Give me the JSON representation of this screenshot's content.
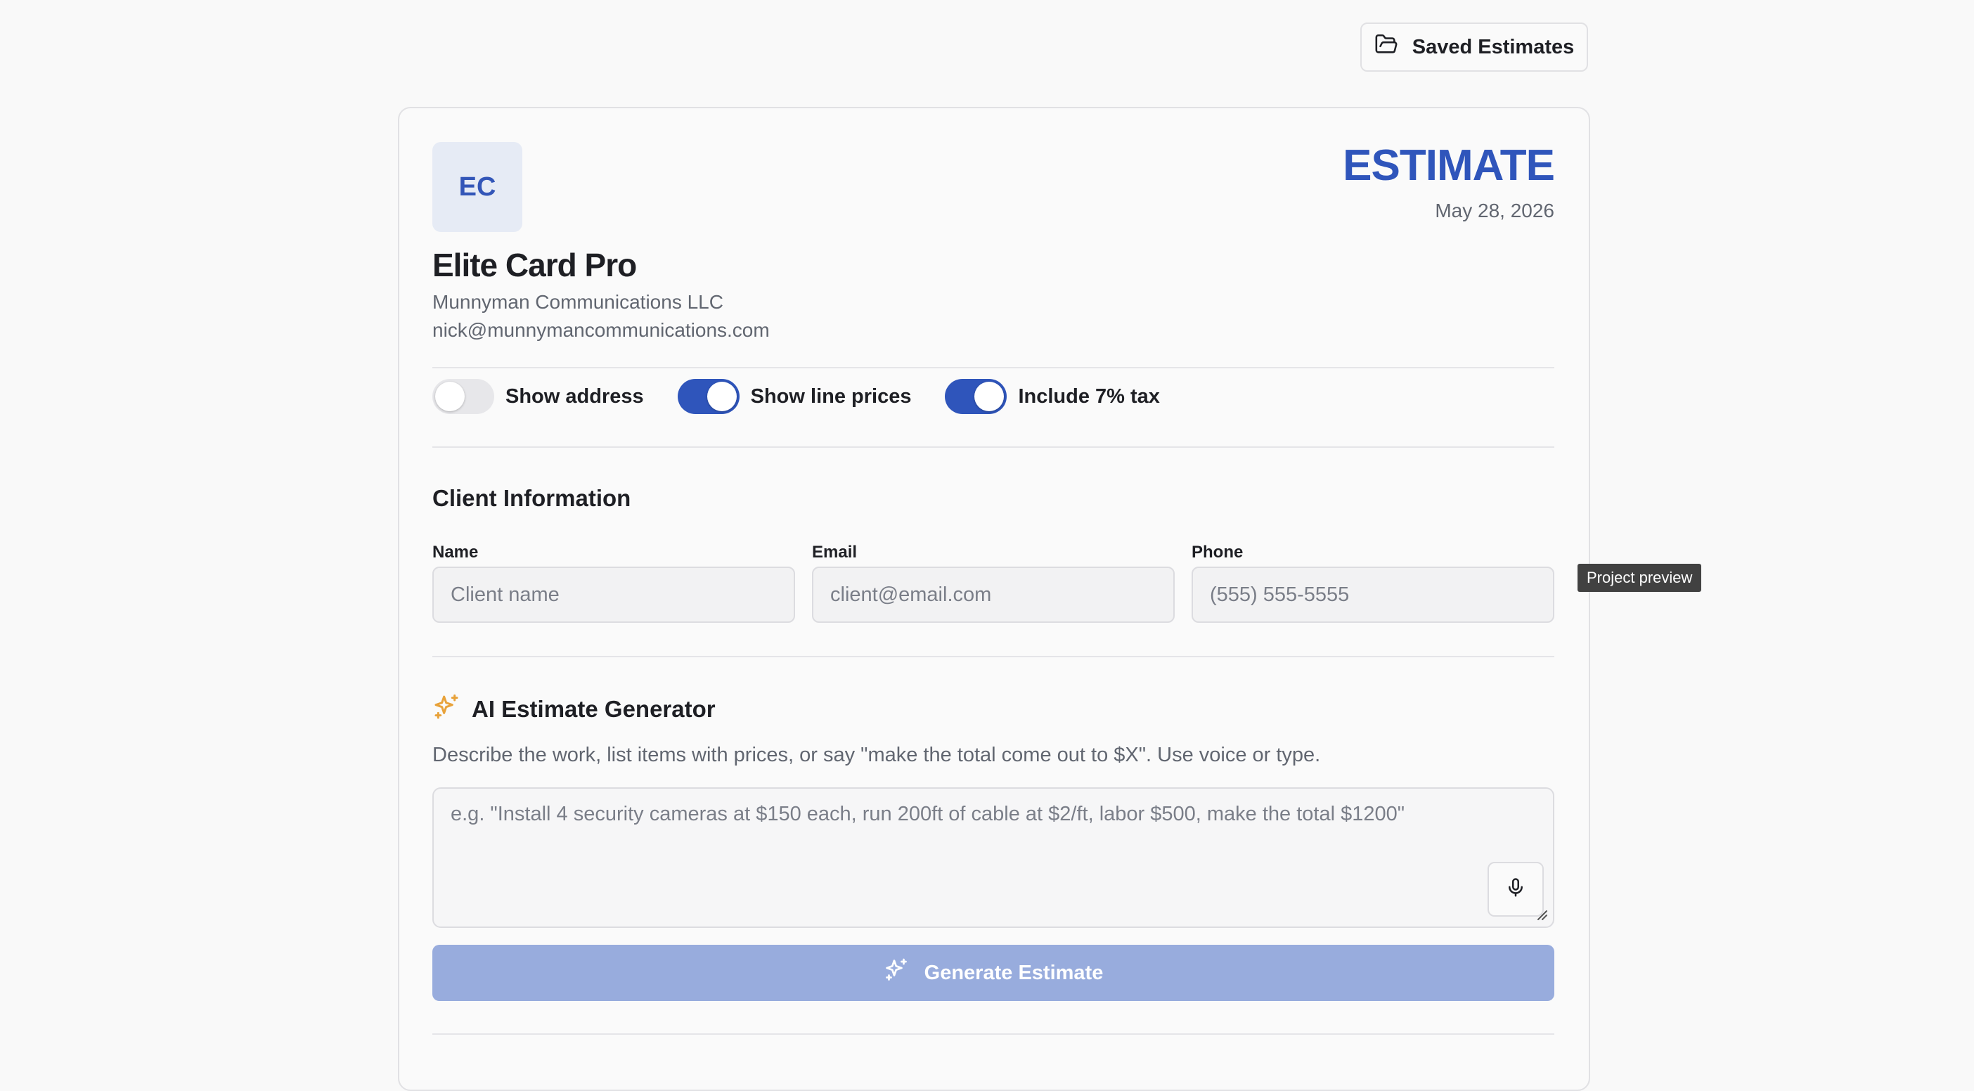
{
  "header": {
    "saved_estimates_label": "Saved Estimates"
  },
  "estimate": {
    "logo_initials": "EC",
    "doc_title": "ESTIMATE",
    "date": "May 28, 2026",
    "brand_name": "Elite Card Pro",
    "company": "Munnyman Communications LLC",
    "email": "nick@munnymancommunications.com"
  },
  "toggles": [
    {
      "label": "Show address",
      "on": false
    },
    {
      "label": "Show line prices",
      "on": true
    },
    {
      "label": "Include 7% tax",
      "on": true
    }
  ],
  "client": {
    "section_title": "Client Information",
    "name_label": "Name",
    "name_placeholder": "Client name",
    "email_label": "Email",
    "email_placeholder": "client@email.com",
    "phone_label": "Phone",
    "phone_placeholder": "(555) 555-5555"
  },
  "ai": {
    "section_title": "AI Estimate Generator",
    "description": "Describe the work, list items with prices, or say \"make the total come out to $X\". Use voice or type.",
    "placeholder": "e.g. \"Install 4 security cameras at $150 each, run 200ft of cable at $2/ft, labor $500, make the total $1200\"",
    "generate_label": "Generate Estimate"
  },
  "tooltip": "Project preview",
  "colors": {
    "accent": "#2f55bb",
    "generate_disabled": "#98acdd",
    "sparkle": "#e8a23a"
  }
}
